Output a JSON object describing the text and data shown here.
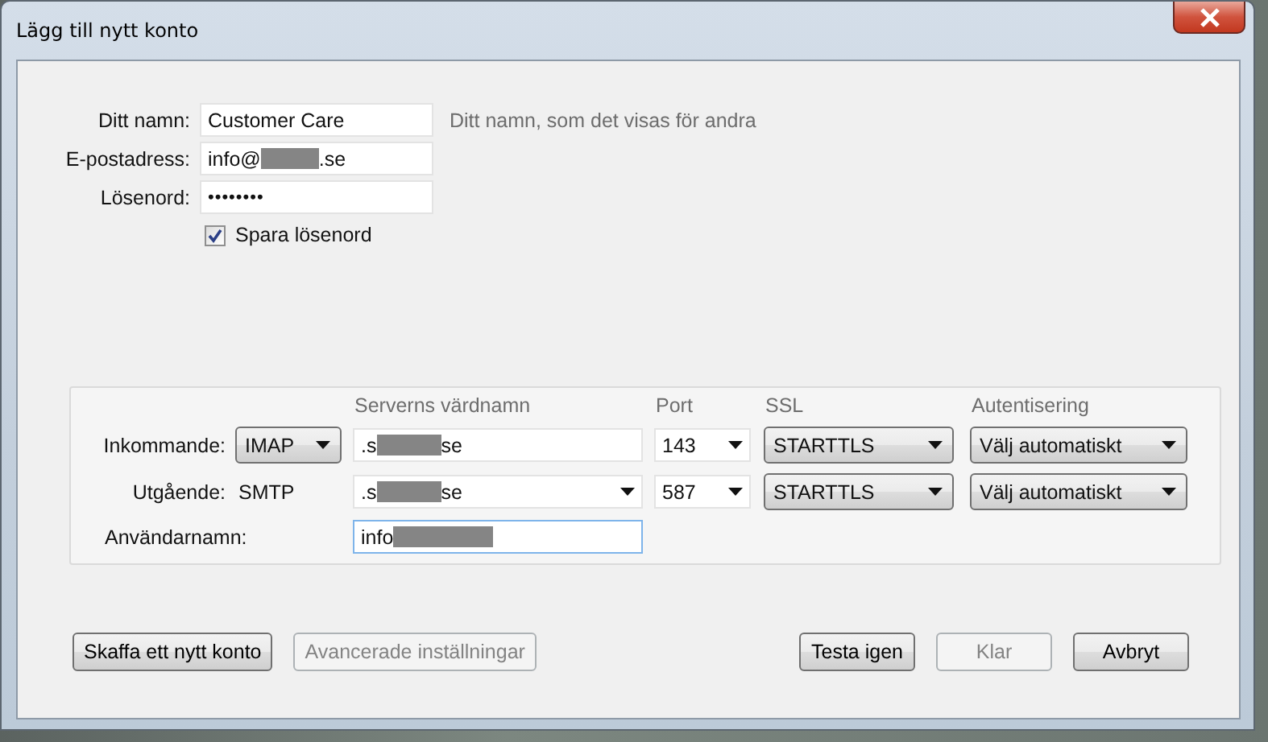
{
  "window": {
    "title": "Lägg till nytt konto"
  },
  "identity": [
    {
      "label": "Ditt namn:",
      "kind": "text",
      "value_start": "Customer Care",
      "hint": "Ditt namn, som det visas för andra"
    },
    {
      "label": "E-postadress:",
      "kind": "text",
      "value_start": "info@",
      "redacted": true,
      "value_end": ".se"
    },
    {
      "label": "Lösenord:",
      "kind": "password",
      "value_start": "••••••••"
    }
  ],
  "save_password": {
    "label": "Spara lösenord",
    "checked": true
  },
  "server": {
    "columns": [
      "Serverns värdnamn",
      "Port",
      "SSL",
      "Autentisering"
    ],
    "rows": [
      {
        "label": "Inkommande:",
        "type": {
          "kind": "dropdown",
          "value": "IMAP"
        },
        "host": {
          "kind": "text",
          "value_start": ".s",
          "redacted": true,
          "value_end": "se"
        },
        "port": "143",
        "ssl": "STARTTLS",
        "auth": "Välj automatiskt"
      },
      {
        "label": "Utgående:",
        "type": {
          "kind": "label",
          "value": "SMTP"
        },
        "host": {
          "kind": "combo",
          "value_start": ".s",
          "redacted": true,
          "value_end": "se"
        },
        "port": "587",
        "ssl": "STARTTLS",
        "auth": "Välj automatiskt"
      }
    ],
    "username": {
      "label": "Användarnamn:",
      "value_start": "info",
      "redacted": true
    }
  },
  "buttons_left": [
    {
      "label": "Skaffa ett nytt konto",
      "disabled": false
    },
    {
      "label": "Avancerade inställningar",
      "disabled": true
    }
  ],
  "buttons_right": [
    {
      "label": "Testa igen",
      "disabled": false
    },
    {
      "label": "Klar",
      "disabled": true
    },
    {
      "label": "Avbryt",
      "disabled": false
    }
  ]
}
